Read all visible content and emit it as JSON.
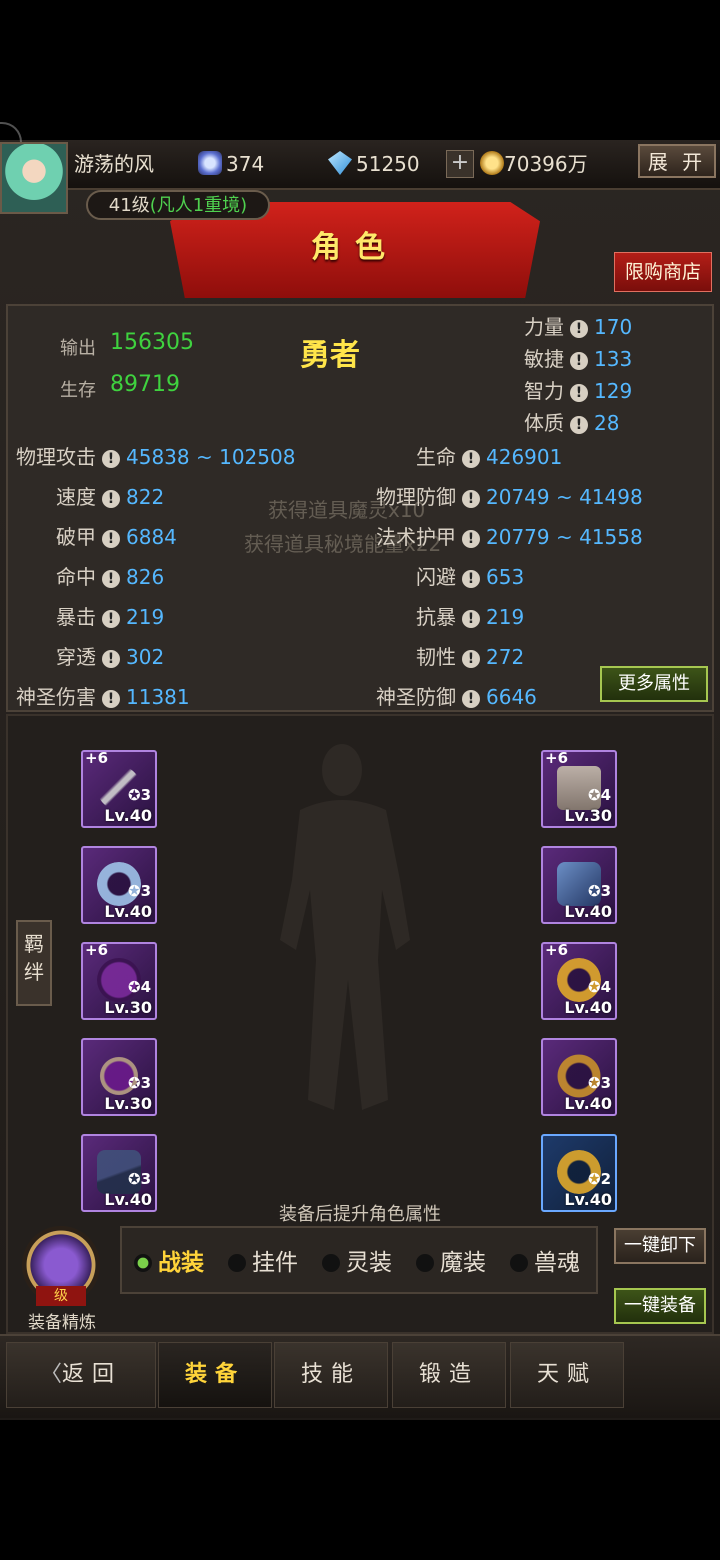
{
  "header": {
    "player_name": "游荡的风",
    "currency1": "374",
    "currency2": "51250",
    "gold": "70396万",
    "expand_label": "展 开",
    "level": "41级",
    "realm": "(凡人1重境)"
  },
  "banner": {
    "title": "角色",
    "shop_label": "限购商店"
  },
  "summary": {
    "output_label": "输出",
    "output_value": "156305",
    "survive_label": "生存",
    "survive_value": "89719",
    "class_name": "勇者"
  },
  "attributes": [
    {
      "label": "力量",
      "value": "170"
    },
    {
      "label": "敏捷",
      "value": "133"
    },
    {
      "label": "智力",
      "value": "129"
    },
    {
      "label": "体质",
      "value": "28"
    }
  ],
  "stats_left": [
    {
      "label": "物理攻击",
      "value": "45838 ~ 102508"
    },
    {
      "label": "速度",
      "value": "822"
    },
    {
      "label": "破甲",
      "value": "6884"
    },
    {
      "label": "命中",
      "value": "826"
    },
    {
      "label": "暴击",
      "value": "219"
    },
    {
      "label": "穿透",
      "value": "302"
    },
    {
      "label": "神圣伤害",
      "value": "11381"
    }
  ],
  "stats_right": [
    {
      "label": "生命",
      "value": "426901"
    },
    {
      "label": "物理防御",
      "value": "20749 ~ 41498"
    },
    {
      "label": "法术护甲",
      "value": "20779 ~ 41558"
    },
    {
      "label": "闪避",
      "value": "653"
    },
    {
      "label": "抗暴",
      "value": "219"
    },
    {
      "label": "韧性",
      "value": "272"
    },
    {
      "label": "神圣防御",
      "value": "6646"
    }
  ],
  "toasts": [
    "获得道具魔灵x10",
    "获得道具秘境能量x22"
  ],
  "more_attr_label": "更多属性",
  "equipment_left": [
    {
      "plus": "+6",
      "stars": "3",
      "level": "Lv.40",
      "icon": "sword-icon"
    },
    {
      "plus": "",
      "stars": "3",
      "level": "Lv.40",
      "icon": "fur-helmet-icon"
    },
    {
      "plus": "+6",
      "stars": "4",
      "level": "Lv.30",
      "icon": "necklace-icon"
    },
    {
      "plus": "",
      "stars": "3",
      "level": "Lv.30",
      "icon": "belt-icon"
    },
    {
      "plus": "",
      "stars": "3",
      "level": "Lv.40",
      "icon": "boots-icon"
    }
  ],
  "equipment_right": [
    {
      "plus": "+6",
      "stars": "4",
      "level": "Lv.30",
      "icon": "coat-icon"
    },
    {
      "plus": "",
      "stars": "3",
      "level": "Lv.40",
      "icon": "gauntlet-icon"
    },
    {
      "plus": "+6",
      "stars": "4",
      "level": "Lv.40",
      "icon": "gold-ring-icon"
    },
    {
      "plus": "",
      "stars": "3",
      "level": "Lv.40",
      "icon": "dark-ring-icon"
    },
    {
      "plus": "",
      "stars": "2",
      "level": "Lv.40",
      "icon": "gold-ring-icon"
    }
  ],
  "bond_label": "羁绊",
  "equip_hint": "装备后提升角色属性",
  "refine": {
    "level_label": "级",
    "label": "装备精炼"
  },
  "equip_tabs": [
    "战装",
    "挂件",
    "灵装",
    "魔装",
    "兽魂"
  ],
  "unequip_all": "一键卸下",
  "equip_all": "一键装备",
  "nav": [
    "返回",
    "装备",
    "技能",
    "锻造",
    "天赋"
  ],
  "colors": {
    "stat_value": "#55b8ff",
    "green": "#3fd23f",
    "gold": "#ffd43a",
    "banner_red": "#c11a14"
  }
}
